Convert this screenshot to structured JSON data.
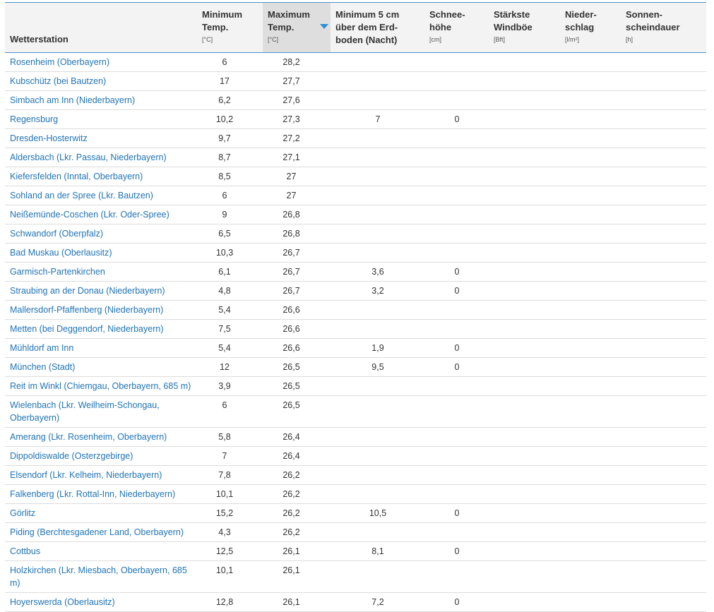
{
  "columns": [
    {
      "label": "Wetterstation",
      "unit": ""
    },
    {
      "label": "Minimum Temp.",
      "unit": "[°C]"
    },
    {
      "label": "Maximum Temp.",
      "unit": "[°C]"
    },
    {
      "label": "Minimum 5 cm über dem Erd- boden (Nacht)",
      "unit": ""
    },
    {
      "label": "Schnee- höhe",
      "unit": "[cm]"
    },
    {
      "label": "Stärkste Windböe",
      "unit": "[Bft]"
    },
    {
      "label": "Nieder- schlag",
      "unit": "[l/m²]"
    },
    {
      "label": "Sonnen- scheindauer",
      "unit": "[h]"
    }
  ],
  "sort": {
    "column": "Maximum Temp.",
    "direction": "descending",
    "indicator_color": "#2a8fd6"
  },
  "colors": {
    "link": "#1f73b7",
    "header_border": "#4a90c8",
    "header_bg": "#f3f3f3",
    "sorted_header_bg": "#dedede"
  },
  "rows": [
    {
      "station": "Rosenheim (Oberbayern)",
      "min": "6",
      "max": "28,2",
      "ground": "",
      "snow": "",
      "gust": "",
      "precip": "",
      "sun": ""
    },
    {
      "station": "Kubschütz (bei Bautzen)",
      "min": "17",
      "max": "27,7",
      "ground": "",
      "snow": "",
      "gust": "",
      "precip": "",
      "sun": ""
    },
    {
      "station": "Simbach am Inn (Niederbayern)",
      "min": "6,2",
      "max": "27,6",
      "ground": "",
      "snow": "",
      "gust": "",
      "precip": "",
      "sun": ""
    },
    {
      "station": "Regensburg",
      "min": "10,2",
      "max": "27,3",
      "ground": "7",
      "snow": "0",
      "gust": "",
      "precip": "",
      "sun": ""
    },
    {
      "station": "Dresden-Hosterwitz",
      "min": "9,7",
      "max": "27,2",
      "ground": "",
      "snow": "",
      "gust": "",
      "precip": "",
      "sun": ""
    },
    {
      "station": "Aldersbach (Lkr. Passau, Niederbayern)",
      "min": "8,7",
      "max": "27,1",
      "ground": "",
      "snow": "",
      "gust": "",
      "precip": "",
      "sun": ""
    },
    {
      "station": "Kiefersfelden (Inntal, Oberbayern)",
      "min": "8,5",
      "max": "27",
      "ground": "",
      "snow": "",
      "gust": "",
      "precip": "",
      "sun": ""
    },
    {
      "station": "Sohland an der Spree (Lkr. Bautzen)",
      "min": "6",
      "max": "27",
      "ground": "",
      "snow": "",
      "gust": "",
      "precip": "",
      "sun": ""
    },
    {
      "station": "Neißemünde-Coschen (Lkr. Oder-Spree)",
      "min": "9",
      "max": "26,8",
      "ground": "",
      "snow": "",
      "gust": "",
      "precip": "",
      "sun": ""
    },
    {
      "station": "Schwandorf (Oberpfalz)",
      "min": "6,5",
      "max": "26,8",
      "ground": "",
      "snow": "",
      "gust": "",
      "precip": "",
      "sun": ""
    },
    {
      "station": "Bad Muskau (Oberlausitz)",
      "min": "10,3",
      "max": "26,7",
      "ground": "",
      "snow": "",
      "gust": "",
      "precip": "",
      "sun": ""
    },
    {
      "station": "Garmisch-Partenkirchen",
      "min": "6,1",
      "max": "26,7",
      "ground": "3,6",
      "snow": "0",
      "gust": "",
      "precip": "",
      "sun": ""
    },
    {
      "station": "Straubing an der Donau (Niederbayern)",
      "min": "4,8",
      "max": "26,7",
      "ground": "3,2",
      "snow": "0",
      "gust": "",
      "precip": "",
      "sun": ""
    },
    {
      "station": "Mallersdorf-Pfaffenberg (Niederbayern)",
      "min": "5,4",
      "max": "26,6",
      "ground": "",
      "snow": "",
      "gust": "",
      "precip": "",
      "sun": ""
    },
    {
      "station": "Metten (bei Deggendorf, Niederbayern)",
      "min": "7,5",
      "max": "26,6",
      "ground": "",
      "snow": "",
      "gust": "",
      "precip": "",
      "sun": ""
    },
    {
      "station": "Mühldorf am Inn",
      "min": "5,4",
      "max": "26,6",
      "ground": "1,9",
      "snow": "0",
      "gust": "",
      "precip": "",
      "sun": ""
    },
    {
      "station": "München (Stadt)",
      "min": "12",
      "max": "26,5",
      "ground": "9,5",
      "snow": "0",
      "gust": "",
      "precip": "",
      "sun": ""
    },
    {
      "station": "Reit im Winkl (Chiemgau, Oberbayern, 685 m)",
      "min": "3,9",
      "max": "26,5",
      "ground": "",
      "snow": "",
      "gust": "",
      "precip": "",
      "sun": ""
    },
    {
      "station": "Wielenbach (Lkr. Weilheim-Schongau, Oberbayern)",
      "min": "6",
      "max": "26,5",
      "ground": "",
      "snow": "",
      "gust": "",
      "precip": "",
      "sun": ""
    },
    {
      "station": "Amerang (Lkr. Rosenheim, Oberbayern)",
      "min": "5,8",
      "max": "26,4",
      "ground": "",
      "snow": "",
      "gust": "",
      "precip": "",
      "sun": ""
    },
    {
      "station": "Dippoldiswalde (Osterzgebirge)",
      "min": "7",
      "max": "26,4",
      "ground": "",
      "snow": "",
      "gust": "",
      "precip": "",
      "sun": ""
    },
    {
      "station": "Elsendorf (Lkr. Kelheim, Niederbayern)",
      "min": "7,8",
      "max": "26,2",
      "ground": "",
      "snow": "",
      "gust": "",
      "precip": "",
      "sun": ""
    },
    {
      "station": "Falkenberg (Lkr. Rottal-Inn, Niederbayern)",
      "min": "10,1",
      "max": "26,2",
      "ground": "",
      "snow": "",
      "gust": "",
      "precip": "",
      "sun": ""
    },
    {
      "station": "Görlitz",
      "min": "15,2",
      "max": "26,2",
      "ground": "10,5",
      "snow": "0",
      "gust": "",
      "precip": "",
      "sun": ""
    },
    {
      "station": "Piding (Berchtesgadener Land, Oberbayern)",
      "min": "4,3",
      "max": "26,2",
      "ground": "",
      "snow": "",
      "gust": "",
      "precip": "",
      "sun": ""
    },
    {
      "station": "Cottbus",
      "min": "12,5",
      "max": "26,1",
      "ground": "8,1",
      "snow": "0",
      "gust": "",
      "precip": "",
      "sun": ""
    },
    {
      "station": "Holzkirchen (Lkr. Miesbach, Oberbayern, 685 m)",
      "min": "10,1",
      "max": "26,1",
      "ground": "",
      "snow": "",
      "gust": "",
      "precip": "",
      "sun": ""
    },
    {
      "station": "Hoyerswerda (Oberlausitz)",
      "min": "12,8",
      "max": "26,1",
      "ground": "7,2",
      "snow": "0",
      "gust": "",
      "precip": "",
      "sun": ""
    }
  ]
}
